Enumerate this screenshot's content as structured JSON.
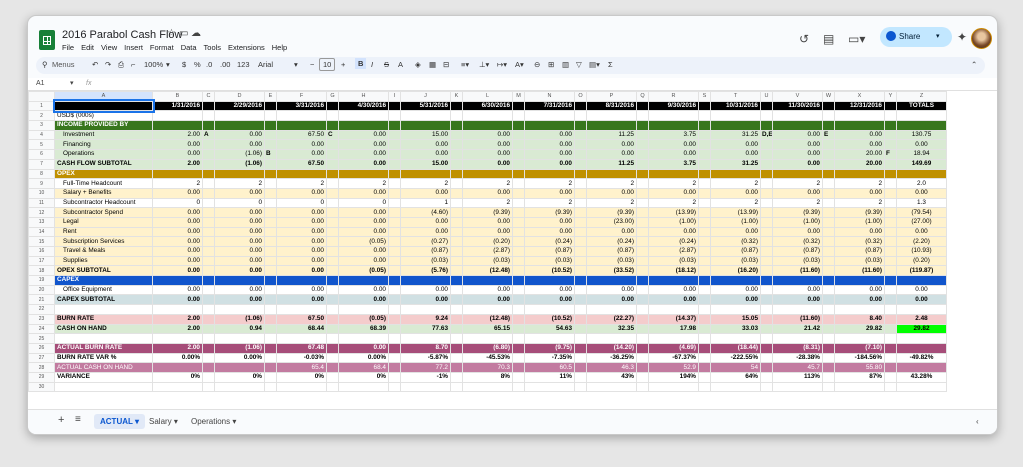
{
  "app": {
    "title": "2016 Parabol Cash Flow"
  },
  "menu": [
    "File",
    "Edit",
    "View",
    "Insert",
    "Format",
    "Data",
    "Tools",
    "Extensions",
    "Help"
  ],
  "share_label": "Share",
  "toolbar": {
    "menus_label": "Menus",
    "zoom": "100%",
    "currency": "$",
    "percent": "%",
    "dec_less": ".0",
    "dec_more": ".00",
    "fmt123": "123",
    "font": "Arial",
    "font_size": "10"
  },
  "formula_bar": {
    "cell_ref": "A1",
    "fx": "fx"
  },
  "columns": [
    "A",
    "B",
    "C",
    "D",
    "E",
    "F",
    "G",
    "H",
    "I",
    "J",
    "K",
    "L",
    "M",
    "N",
    "O",
    "P",
    "Q",
    "R",
    "S",
    "T",
    "U",
    "V",
    "W",
    "X",
    "Y",
    "Z"
  ],
  "rows": [
    {
      "n": "1",
      "label": "",
      "cells": [
        "1/31/2016",
        "2/29/2016",
        "3/31/2016",
        "4/30/2016",
        "5/31/2016",
        "6/30/2016",
        "7/31/2016",
        "8/31/2016",
        "9/30/2016",
        "10/31/2016",
        "11/30/2016",
        "12/31/2016",
        "TOTALS"
      ],
      "style": "date"
    },
    {
      "n": "2",
      "label": "USD$ (000s)",
      "cells": [
        "",
        "",
        "",
        "",
        "",
        "",
        "",
        "",
        "",
        "",
        "",
        "",
        ""
      ],
      "style": "plain"
    },
    {
      "n": "3",
      "label": "INCOME PROVIDED BY",
      "cells": [
        "",
        "",
        "",
        "",
        "",
        "",
        "",
        "",
        "",
        "",
        "",
        "",
        ""
      ],
      "style": "green"
    },
    {
      "n": "4",
      "label": "Investment",
      "cells": [
        "2.00",
        "0.00",
        "67.50",
        "0.00",
        "15.00",
        "0.00",
        "0.00",
        "11.25",
        "3.75",
        "31.25",
        "0.00",
        "0.00",
        "130.75"
      ],
      "notes": [
        "A",
        "",
        "C",
        "",
        "",
        "",
        "",
        "",
        "",
        "D,E",
        "E",
        "",
        ""
      ],
      "style": "lgreen",
      "indent": true
    },
    {
      "n": "5",
      "label": "Financing",
      "cells": [
        "0.00",
        "0.00",
        "0.00",
        "0.00",
        "0.00",
        "0.00",
        "0.00",
        "0.00",
        "0.00",
        "0.00",
        "0.00",
        "0.00",
        "0.00"
      ],
      "style": "lgreen",
      "indent": true
    },
    {
      "n": "6",
      "label": "Operations",
      "cells": [
        "0.00",
        "(1.06)",
        "0.00",
        "0.00",
        "0.00",
        "0.00",
        "0.00",
        "0.00",
        "0.00",
        "0.00",
        "0.00",
        "20.00",
        "18.94"
      ],
      "notes": [
        "",
        "B",
        "",
        "",
        "",
        "",
        "",
        "",
        "",
        "",
        "",
        "F",
        ""
      ],
      "style": "lgreen",
      "indent": true
    },
    {
      "n": "7",
      "label": "CASH FLOW SUBTOTAL",
      "cells": [
        "2.00",
        "(1.06)",
        "67.50",
        "0.00",
        "15.00",
        "0.00",
        "0.00",
        "11.25",
        "3.75",
        "31.25",
        "0.00",
        "20.00",
        "149.69"
      ],
      "style": "lgreenbold"
    },
    {
      "n": "8",
      "label": "OPEX",
      "cells": [
        "",
        "",
        "",
        "",
        "",
        "",
        "",
        "",
        "",
        "",
        "",
        "",
        ""
      ],
      "style": "gold"
    },
    {
      "n": "9",
      "label": "Full-Time Headcount",
      "cells": [
        "2",
        "2",
        "2",
        "2",
        "2",
        "2",
        "2",
        "2",
        "2",
        "2",
        "2",
        "2",
        "2.0"
      ],
      "style": "white",
      "indent": true
    },
    {
      "n": "10",
      "label": "Salary + Benefits",
      "cells": [
        "0.00",
        "0.00",
        "0.00",
        "0.00",
        "0.00",
        "0.00",
        "0.00",
        "0.00",
        "0.00",
        "0.00",
        "0.00",
        "0.00",
        "0.00"
      ],
      "style": "cream",
      "indent": true
    },
    {
      "n": "11",
      "label": "Subcontractor Headcount",
      "cells": [
        "0",
        "0",
        "0",
        "0",
        "1",
        "2",
        "2",
        "2",
        "2",
        "2",
        "2",
        "2",
        "1.3"
      ],
      "style": "white",
      "indent": true
    },
    {
      "n": "12",
      "label": "Subcontractor Spend",
      "cells": [
        "0.00",
        "0.00",
        "0.00",
        "0.00",
        "(4.60)",
        "(9.39)",
        "(9.39)",
        "(9.39)",
        "(13.99)",
        "(13.99)",
        "(9.39)",
        "(9.39)",
        "(79.54)"
      ],
      "style": "cream",
      "indent": true
    },
    {
      "n": "13",
      "label": "Legal",
      "cells": [
        "0.00",
        "0.00",
        "0.00",
        "0.00",
        "0.00",
        "0.00",
        "0.00",
        "(23.00)",
        "(1.00)",
        "(1.00)",
        "(1.00)",
        "(1.00)",
        "(27.00)"
      ],
      "style": "cream",
      "indent": true
    },
    {
      "n": "14",
      "label": "Rent",
      "cells": [
        "0.00",
        "0.00",
        "0.00",
        "0.00",
        "0.00",
        "0.00",
        "0.00",
        "0.00",
        "0.00",
        "0.00",
        "0.00",
        "0.00",
        "0.00"
      ],
      "style": "cream",
      "indent": true
    },
    {
      "n": "15",
      "label": "Subscription Services",
      "cells": [
        "0.00",
        "0.00",
        "0.00",
        "(0.05)",
        "(0.27)",
        "(0.20)",
        "(0.24)",
        "(0.24)",
        "(0.24)",
        "(0.32)",
        "(0.32)",
        "(0.32)",
        "(2.20)"
      ],
      "style": "cream",
      "indent": true
    },
    {
      "n": "16",
      "label": "Travel & Meals",
      "cells": [
        "0.00",
        "0.00",
        "0.00",
        "0.00",
        "(0.87)",
        "(2.87)",
        "(0.87)",
        "(0.87)",
        "(2.87)",
        "(0.87)",
        "(0.87)",
        "(0.87)",
        "(10.93)"
      ],
      "style": "cream",
      "indent": true
    },
    {
      "n": "17",
      "label": "Supplies",
      "cells": [
        "0.00",
        "0.00",
        "0.00",
        "0.00",
        "(0.03)",
        "(0.03)",
        "(0.03)",
        "(0.03)",
        "(0.03)",
        "(0.03)",
        "(0.03)",
        "(0.03)",
        "(0.20)"
      ],
      "style": "cream",
      "indent": true
    },
    {
      "n": "18",
      "label": "OPEX SUBTOTAL",
      "cells": [
        "0.00",
        "0.00",
        "0.00",
        "(0.05)",
        "(5.76)",
        "(12.48)",
        "(10.52)",
        "(33.52)",
        "(18.12)",
        "(16.20)",
        "(11.60)",
        "(11.60)",
        "(119.87)"
      ],
      "style": "creambold"
    },
    {
      "n": "19",
      "label": "CAPEX",
      "cells": [
        "",
        "",
        "",
        "",
        "",
        "",
        "",
        "",
        "",
        "",
        "",
        "",
        ""
      ],
      "style": "blue"
    },
    {
      "n": "20",
      "label": "Office Equipment",
      "cells": [
        "0.00",
        "0.00",
        "0.00",
        "0.00",
        "0.00",
        "0.00",
        "0.00",
        "0.00",
        "0.00",
        "0.00",
        "0.00",
        "0.00",
        "0.00"
      ],
      "style": "white",
      "indent": true
    },
    {
      "n": "21",
      "label": "CAPEX SUBTOTAL",
      "cells": [
        "0.00",
        "0.00",
        "0.00",
        "0.00",
        "0.00",
        "0.00",
        "0.00",
        "0.00",
        "0.00",
        "0.00",
        "0.00",
        "0.00",
        "0.00"
      ],
      "style": "greybold"
    },
    {
      "n": "22",
      "label": "",
      "cells": [
        "",
        "",
        "",
        "",
        "",
        "",
        "",
        "",
        "",
        "",
        "",
        "",
        ""
      ],
      "style": "plain"
    },
    {
      "n": "23",
      "label": "BURN RATE",
      "cells": [
        "2.00",
        "(1.06)",
        "67.50",
        "(0.05)",
        "9.24",
        "(12.48)",
        "(10.52)",
        "(22.27)",
        "(14.37)",
        "15.05",
        "(11.60)",
        "8.40",
        "2.48"
      ],
      "style": "pinkbold"
    },
    {
      "n": "24",
      "label": "CASH ON HAND",
      "cells": [
        "2.00",
        "0.94",
        "68.44",
        "68.39",
        "77.63",
        "65.15",
        "54.63",
        "32.35",
        "17.98",
        "33.03",
        "21.42",
        "29.82",
        "29.82"
      ],
      "style": "lgreenbold",
      "last_green": true
    },
    {
      "n": "25",
      "label": "",
      "cells": [
        "",
        "",
        "",
        "",
        "",
        "",
        "",
        "",
        "",
        "",
        "",
        "",
        ""
      ],
      "style": "plain"
    },
    {
      "n": "26",
      "label": "ACTUAL BURN RATE",
      "cells": [
        "2.00",
        "(1.06)",
        "67.48",
        "0.00",
        "8.70",
        "(6.80)",
        "(9.75)",
        "(14.20)",
        "(4.69)",
        "(18.44)",
        "(8.31)",
        "(7.10)",
        ""
      ],
      "style": "plumbold"
    },
    {
      "n": "27",
      "label": "BURN RATE VAR %",
      "cells": [
        "0.00%",
        "0.00%",
        "-0.03%",
        "0.00%",
        "-5.87%",
        "-45.53%",
        "-7.35%",
        "-36.25%",
        "-67.37%",
        "-222.55%",
        "-28.38%",
        "-184.56%",
        "-49.82%"
      ],
      "style": "whitebold"
    },
    {
      "n": "28",
      "label": "ACTUAL CASH ON HAND",
      "cells": [
        "",
        "",
        "65.4",
        "68.4",
        "77.2",
        "70.3",
        "60.5",
        "46.3",
        "52.9",
        "54",
        "45.7",
        "55.80",
        ""
      ],
      "style": "mauve"
    },
    {
      "n": "29",
      "label": "VARIANCE",
      "cells": [
        "0%",
        "0%",
        "0%",
        "0%",
        "-1%",
        "8%",
        "11%",
        "43%",
        "194%",
        "64%",
        "113%",
        "87%",
        "43.28%"
      ],
      "style": "whitebold"
    },
    {
      "n": "30",
      "label": "",
      "cells": [
        "",
        "",
        "",
        "",
        "",
        "",
        "",
        "",
        "",
        "",
        "",
        "",
        ""
      ],
      "style": "plain"
    }
  ],
  "sheets": {
    "add": "+",
    "list": "≡",
    "tabs": [
      "ACTUAL",
      "Salary",
      "Operations"
    ]
  },
  "colors": {
    "green": "#38761d",
    "lgreen": "#d9ead3",
    "gold": "#bf9000",
    "cream": "#fff2cc",
    "blue": "#1155cc",
    "grey": "#d0e0e3",
    "pink": "#f4cccc",
    "plum": "#a64d79",
    "mauve": "#c27ba0",
    "bright_green": "#00ff00"
  }
}
